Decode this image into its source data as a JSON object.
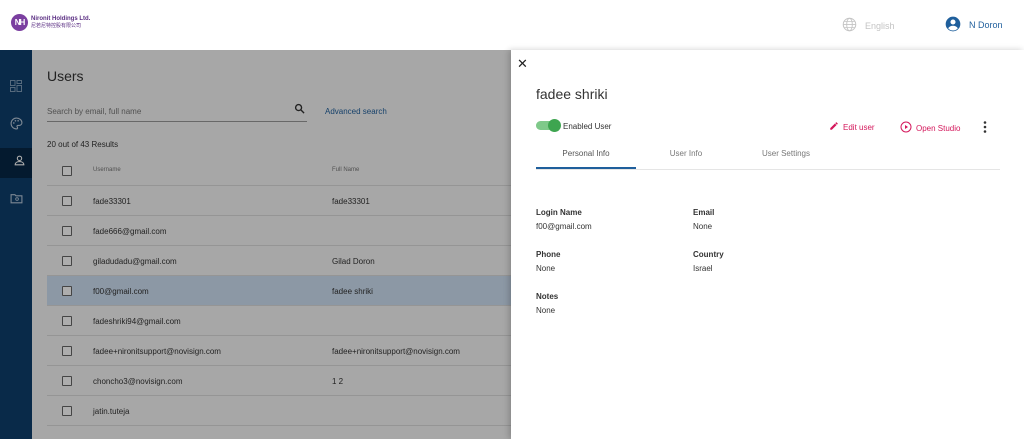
{
  "brand": {
    "logo_mark": "NH",
    "name_line1": "Nironit Holdings Ltd.",
    "name_line2": "尼若尼特控股有限公司"
  },
  "header": {
    "language": "English",
    "user_name": "N Doron"
  },
  "rail": {
    "items": [
      "dashboard-icon",
      "palette-icon",
      "users-icon",
      "media-folder-icon"
    ],
    "active_index": 2
  },
  "users_page": {
    "title": "Users",
    "search_placeholder": "Search by email, full name",
    "advanced_search": "Advanced search",
    "results_count": "20 out of 43 Results",
    "columns": {
      "username": "Username",
      "full_name": "Full Name"
    },
    "rows": [
      {
        "username": "fade33301",
        "full_name": "fade33301",
        "selected": false
      },
      {
        "username": "fade666@gmail.com",
        "full_name": "",
        "selected": false
      },
      {
        "username": "giladudadu@gmail.com",
        "full_name": "Gilad Doron",
        "selected": false
      },
      {
        "username": "f00@gmail.com",
        "full_name": "fadee shriki",
        "selected": true
      },
      {
        "username": "fadeshriki94@gmail.com",
        "full_name": "",
        "selected": false
      },
      {
        "username": "fadee+nironitsupport@novisign.com",
        "full_name": "fadee+nironitsupport@novisign.com",
        "selected": false
      },
      {
        "username": "choncho3@novisign.com",
        "full_name": "1 2",
        "selected": false
      },
      {
        "username": "jatin.tuteja",
        "full_name": "",
        "selected": false
      }
    ]
  },
  "drawer": {
    "title": "fadee shriki",
    "enabled_label": "Enabled User",
    "enabled": true,
    "edit_label": "Edit user",
    "open_studio_label": "Open Studio",
    "tabs": [
      "Personal Info",
      "User Info",
      "User Settings"
    ],
    "active_tab": 0,
    "fields": {
      "login_name_label": "Login Name",
      "login_name": "f00@gmail.com",
      "email_label": "Email",
      "email": "None",
      "phone_label": "Phone",
      "phone": "None",
      "country_label": "Country",
      "country": "Israel",
      "notes_label": "Notes",
      "notes": "None"
    }
  },
  "colors": {
    "rail": "#0e3f6c",
    "accent_blue": "#1f5f9c",
    "action_pink": "#d4185c",
    "toggle_green": "#3ea550"
  }
}
